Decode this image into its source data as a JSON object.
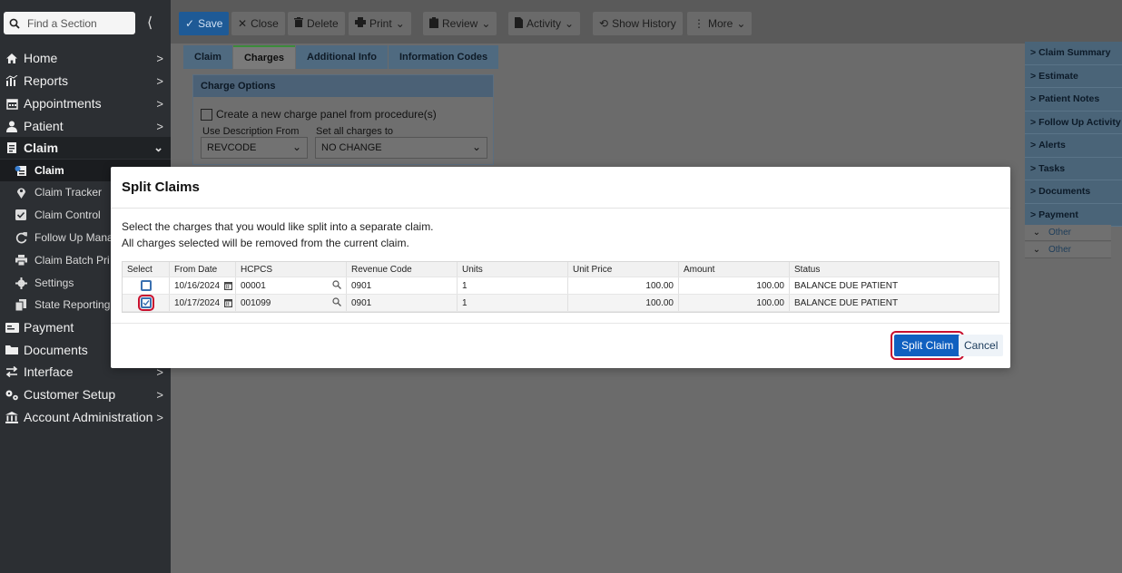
{
  "sidebar": {
    "search_placeholder": "Find a Section",
    "items": [
      {
        "label": "Home",
        "icon": "home-icon"
      },
      {
        "label": "Reports",
        "icon": "reports-icon"
      },
      {
        "label": "Appointments",
        "icon": "calendar-icon"
      },
      {
        "label": "Patient",
        "icon": "user-icon"
      },
      {
        "label": "Claim",
        "icon": "claim-icon"
      },
      {
        "label": "Payment",
        "icon": "payment-icon"
      },
      {
        "label": "Documents",
        "icon": "folder-icon"
      },
      {
        "label": "Interface",
        "icon": "swap-icon"
      },
      {
        "label": "Customer Setup",
        "icon": "gears-icon"
      },
      {
        "label": "Account Administration",
        "icon": "bank-icon"
      }
    ],
    "claim_sub": [
      {
        "label": "Claim",
        "icon": "claim-icon"
      },
      {
        "label": "Claim Tracker",
        "icon": "pin-icon"
      },
      {
        "label": "Claim Control",
        "icon": "checkbox-icon"
      },
      {
        "label": "Follow Up Mana",
        "icon": "refresh-icon"
      },
      {
        "label": "Claim Batch Pri",
        "icon": "printer-icon"
      },
      {
        "label": "Settings",
        "icon": "gear-icon"
      },
      {
        "label": "State Reporting",
        "icon": "copy-icon"
      }
    ]
  },
  "toolbar": {
    "save": "Save",
    "close": "Close",
    "delete": "Delete",
    "print": "Print",
    "review": "Review",
    "activity": "Activity",
    "show_history": "Show History",
    "more": "More"
  },
  "tabs": [
    "Claim",
    "Charges",
    "Additional Info",
    "Information Codes"
  ],
  "charge_options": {
    "header": "Charge Options",
    "checkbox_label": "Create a new charge panel from procedure(s)",
    "use_desc_label": "Use Description From",
    "use_desc_value": "REVCODE",
    "set_all_label": "Set all charges to",
    "set_all_value": "NO CHANGE"
  },
  "right_panel": {
    "items": [
      "Claim Summary",
      "Estimate",
      "Patient Notes",
      "Follow Up Activity",
      "Alerts",
      "Tasks",
      "Documents",
      "Payment"
    ],
    "other_rows": [
      "Other",
      "Other"
    ]
  },
  "modal": {
    "title": "Split Claims",
    "msg1": "Select the charges that you would like split into a separate claim.",
    "msg2": "All charges selected will be removed from the current claim.",
    "columns": [
      "Select",
      "From Date",
      "HCPCS",
      "Revenue Code",
      "Units",
      "Unit Price",
      "Amount",
      "Status"
    ],
    "rows": [
      {
        "checked": false,
        "from_date": "10/16/2024",
        "hcpcs": "00001",
        "revenue_code": "0901",
        "units": "1",
        "unit_price": "100.00",
        "amount": "100.00",
        "status": "BALANCE DUE PATIENT"
      },
      {
        "checked": true,
        "from_date": "10/17/2024",
        "hcpcs": "001099",
        "revenue_code": "0901",
        "units": "1",
        "unit_price": "100.00",
        "amount": "100.00",
        "status": "BALANCE DUE PATIENT"
      }
    ],
    "split_button": "Split Claim",
    "cancel_button": "Cancel"
  },
  "colors": {
    "sidebar_bg": "#2c2f33",
    "accent_blue": "#1060c0",
    "highlight_red": "#c8102e"
  }
}
